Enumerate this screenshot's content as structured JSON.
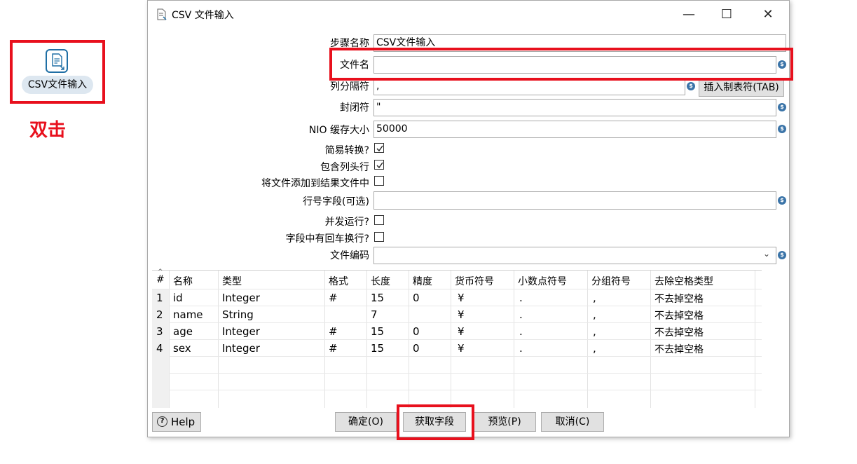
{
  "step": {
    "label": "CSV文件输入",
    "caption": "双击"
  },
  "window": {
    "title": "CSV 文件输入",
    "minimize": "—",
    "maximize": "☐",
    "close": "✕"
  },
  "form": {
    "step_name_label": "步骤名称",
    "step_name_value": "CSV文件输入",
    "filename_label": "文件名",
    "filename_value": "",
    "delimiter_label": "列分隔符",
    "delimiter_value": ",",
    "insert_tab_label": "插入制表符(TAB)",
    "enclosure_label": "封闭符",
    "enclosure_value": "\"",
    "nio_label": "NIO 缓存大小",
    "nio_value": "50000",
    "lazy_label": "简易转换?",
    "lazy_checked": true,
    "header_label": "包含列头行",
    "header_checked": true,
    "add_result_label": "将文件添加到结果文件中",
    "add_result_checked": false,
    "rownum_label": "行号字段(可选)",
    "rownum_value": "",
    "parallel_label": "并发运行?",
    "parallel_checked": false,
    "newline_label": "字段中有回车换行?",
    "newline_checked": false,
    "encoding_label": "文件编码",
    "encoding_value": ""
  },
  "table": {
    "headers": [
      "#",
      "名称",
      "类型",
      "格式",
      "长度",
      "精度",
      "货币符号",
      "小数点符号",
      "分组符号",
      "去除空格类型"
    ],
    "rows": [
      [
        "1",
        "id",
        "Integer",
        "#",
        "15",
        "0",
        "¥",
        ".",
        ",",
        "不去掉空格"
      ],
      [
        "2",
        "name",
        "String",
        "",
        "7",
        "",
        "¥",
        ".",
        ",",
        "不去掉空格"
      ],
      [
        "3",
        "age",
        "Integer",
        "#",
        "15",
        "0",
        "¥",
        ".",
        ",",
        "不去掉空格"
      ],
      [
        "4",
        "sex",
        "Integer",
        "#",
        "15",
        "0",
        "¥",
        ".",
        ",",
        "不去掉空格"
      ]
    ]
  },
  "buttons": {
    "help": "Help",
    "ok": "确定(O)",
    "get_fields": "获取字段",
    "preview": "预览(P)",
    "cancel": "取消(C)"
  },
  "colors": {
    "highlight": "#e8101d",
    "accent": "#1f6fa5"
  }
}
